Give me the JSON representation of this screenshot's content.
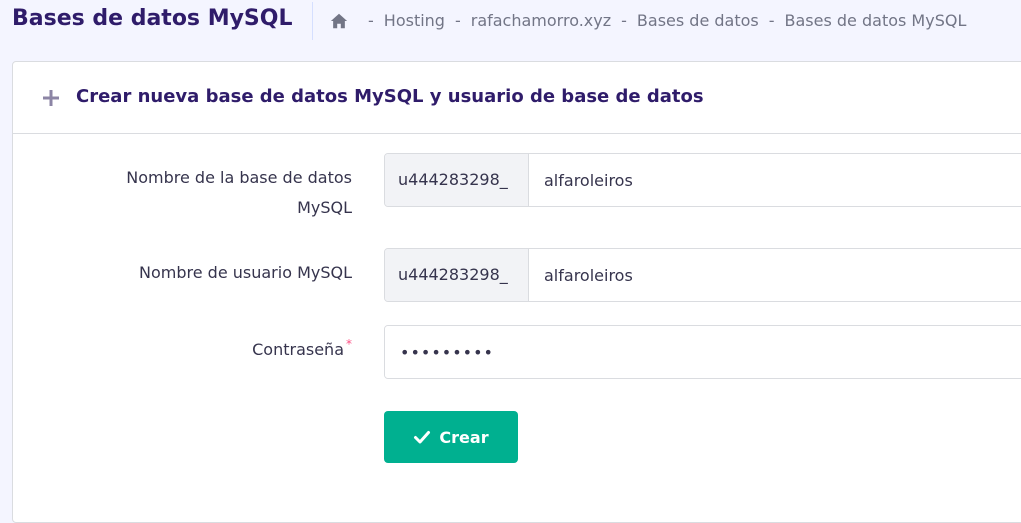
{
  "header": {
    "title": "Bases de datos MySQL",
    "breadcrumb": [
      "Hosting",
      "rafachamorro.xyz",
      "Bases de datos",
      "Bases de datos MySQL"
    ],
    "separator": "-"
  },
  "card": {
    "title": "Crear nueva base de datos MySQL y usuario de base de datos"
  },
  "form": {
    "db_name": {
      "label": "Nombre de la base de datos MySQL",
      "prefix": "u444283298_",
      "value": "alfaroleiros"
    },
    "db_user": {
      "label": "Nombre de usuario MySQL",
      "prefix": "u444283298_",
      "value": "alfaroleiros"
    },
    "password": {
      "label": "Contraseña",
      "required_mark": "*",
      "value": "•••••••••"
    },
    "submit_label": "Crear"
  },
  "colors": {
    "accent": "#00b090",
    "title": "#2f1c6a",
    "required": "#fc5185"
  },
  "icons": {
    "home": "home-icon",
    "plus": "plus-icon",
    "check": "check-icon"
  }
}
